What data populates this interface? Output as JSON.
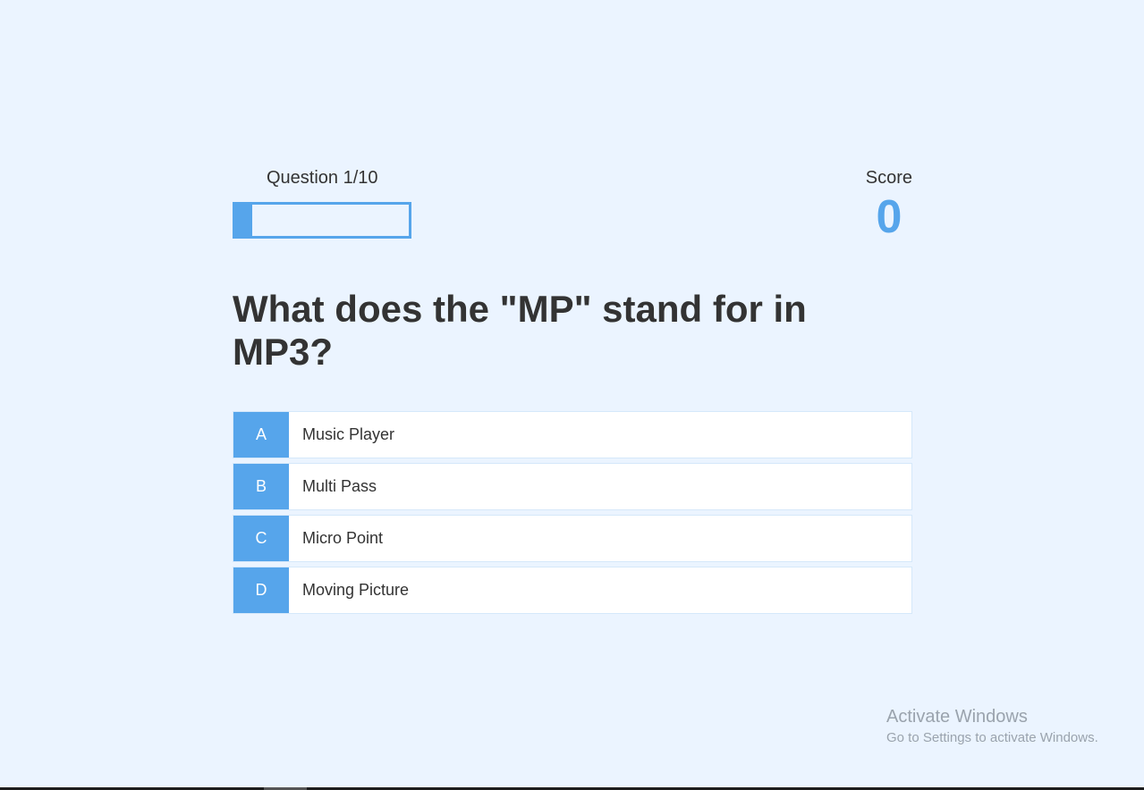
{
  "hud": {
    "progress_text": "Question 1/10",
    "progress_fraction": 0.1,
    "score_label": "Score",
    "score_value": "0"
  },
  "question": {
    "text": "What does the \"MP\" stand for in MP3?"
  },
  "choices": [
    {
      "prefix": "A",
      "text": "Music Player"
    },
    {
      "prefix": "B",
      "text": "Multi Pass"
    },
    {
      "prefix": "C",
      "text": "Micro Point"
    },
    {
      "prefix": "D",
      "text": "Moving Picture"
    }
  ],
  "watermark": {
    "title": "Activate Windows",
    "subtitle": "Go to Settings to activate Windows."
  },
  "colors": {
    "background": "#ebf4ff",
    "accent": "#56a5eb",
    "text": "#333333"
  }
}
